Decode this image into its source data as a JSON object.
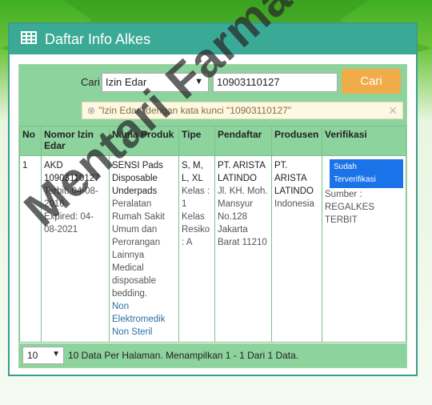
{
  "panel": {
    "title": "Daftar Info Alkes"
  },
  "search": {
    "label": "Cari",
    "category_selected": "Izin Edar",
    "keyword": "10903110127",
    "button_label": "Cari",
    "alert": "\"Izin Edar\" dengan kata kunci \"10903110127\""
  },
  "table": {
    "headers": [
      "No",
      "Nomor Izin Edar",
      "Nama Produk",
      "Tipe",
      "Pendaftar",
      "Produsen",
      "Verifikasi"
    ],
    "rows": [
      {
        "no": "1",
        "nomor": "AKD 10903110127",
        "terbit": "Terbit: 04-08-2016",
        "expired": "Expired: 04-08-2021",
        "produk": "SENSI Pads Disposable Underpads",
        "produk_desc": "Peralatan Rumah Sakit Umum dan Perorangan Lainnya Medical disposable bedding.",
        "produk_cat": "Non Elektromedik Non Steril",
        "tipe": "S, M, L, XL",
        "kelas": "Kelas : 1",
        "kelas_resiko": "Kelas Resiko : A",
        "pendaftar": "PT. ARISTA LATINDO",
        "pendaftar_addr": "Jl. KH. Moh. Mansyur No.128 Jakarta Barat 11210",
        "produsen": "PT. ARISTA LATINDO",
        "produsen_country": "Indonesia",
        "verifikasi_badge": "Sudah Terverifikasi",
        "verifikasi_sumber": "Sumber : REGALKES TERBIT"
      }
    ]
  },
  "footer": {
    "per_page": "10",
    "info": "10 Data Per Halaman. Menampilkan 1 - 1 Dari 1 Data."
  },
  "watermark": "Mentari Farma",
  "colors": {
    "header_teal": "#3aaa96",
    "table_green": "#8dd39d",
    "button_orange": "#f0ac48",
    "badge_blue": "#1a73e8"
  }
}
